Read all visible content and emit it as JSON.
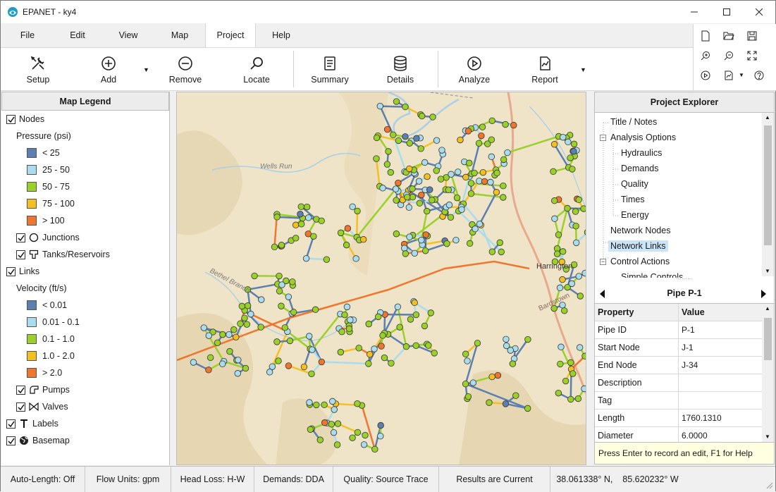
{
  "window": {
    "title": "EPANET - ky4"
  },
  "menu": [
    "File",
    "Edit",
    "View",
    "Map",
    "Project",
    "Help"
  ],
  "ribbon": {
    "setup": "Setup",
    "add": "Add",
    "remove": "Remove",
    "locate": "Locate",
    "summary": "Summary",
    "details": "Details",
    "analyze": "Analyze",
    "report": "Report"
  },
  "legend": {
    "title": "Map Legend",
    "nodes": "Nodes",
    "pressure_label": "Pressure (psi)",
    "pressure_bins": [
      {
        "label": "< 25",
        "color": "#5b7fb0"
      },
      {
        "label": "25 - 50",
        "color": "#a8dcee"
      },
      {
        "label": "50 - 75",
        "color": "#9ad128"
      },
      {
        "label": "75 - 100",
        "color": "#f5c01f"
      },
      {
        "label": "> 100",
        "color": "#f0762d"
      }
    ],
    "junctions": "Junctions",
    "tanks": "Tanks/Reservoirs",
    "links": "Links",
    "velocity_label": "Velocity (ft/s)",
    "velocity_bins": [
      {
        "label": "< 0.01",
        "color": "#5b7fb0"
      },
      {
        "label": "0.01 - 0.1",
        "color": "#a8dcee"
      },
      {
        "label": "0.1 - 1.0",
        "color": "#9ad128"
      },
      {
        "label": "1.0 - 2.0",
        "color": "#f5c01f"
      },
      {
        "label": "> 2.0",
        "color": "#f0762d"
      }
    ],
    "pumps": "Pumps",
    "valves": "Valves",
    "labels": "Labels",
    "basemap": "Basemap"
  },
  "map": {
    "label_wells_run": "Wells Run",
    "label_bethel": "Bethel Branch",
    "label_town": "Harrington",
    "label_road": "Bardstown"
  },
  "explorer": {
    "title": "Project Explorer",
    "tree": {
      "title_notes": "Title / Notes",
      "analysis_options": "Analysis Options",
      "hydraulics": "Hydraulics",
      "demands": "Demands",
      "quality": "Quality",
      "times": "Times",
      "energy": "Energy",
      "network_nodes": "Network Nodes",
      "network_links": "Network Links",
      "control_actions": "Control Actions",
      "simple_controls": "Simple Controls"
    },
    "object_title": "Pipe  P-1",
    "property_header": "Property",
    "value_header": "Value",
    "properties": [
      {
        "name": "Pipe ID",
        "value": "P-1"
      },
      {
        "name": "Start Node",
        "value": "J-1"
      },
      {
        "name": "End Node",
        "value": "J-34"
      },
      {
        "name": "Description",
        "value": ""
      },
      {
        "name": "Tag",
        "value": ""
      },
      {
        "name": "Length",
        "value": "1760.1310"
      },
      {
        "name": "Diameter",
        "value": "6.0000"
      }
    ],
    "hint": "Press Enter to record an edit, F1 for Help"
  },
  "status": {
    "auto_length": "Auto-Length: Off",
    "flow_units": "Flow Units: gpm",
    "head_loss": "Head Loss: H-W",
    "demands": "Demands: DDA",
    "quality": "Quality: Source Trace",
    "results": "Results are Current",
    "coords": "38.061338° N,    85.620232° W"
  }
}
